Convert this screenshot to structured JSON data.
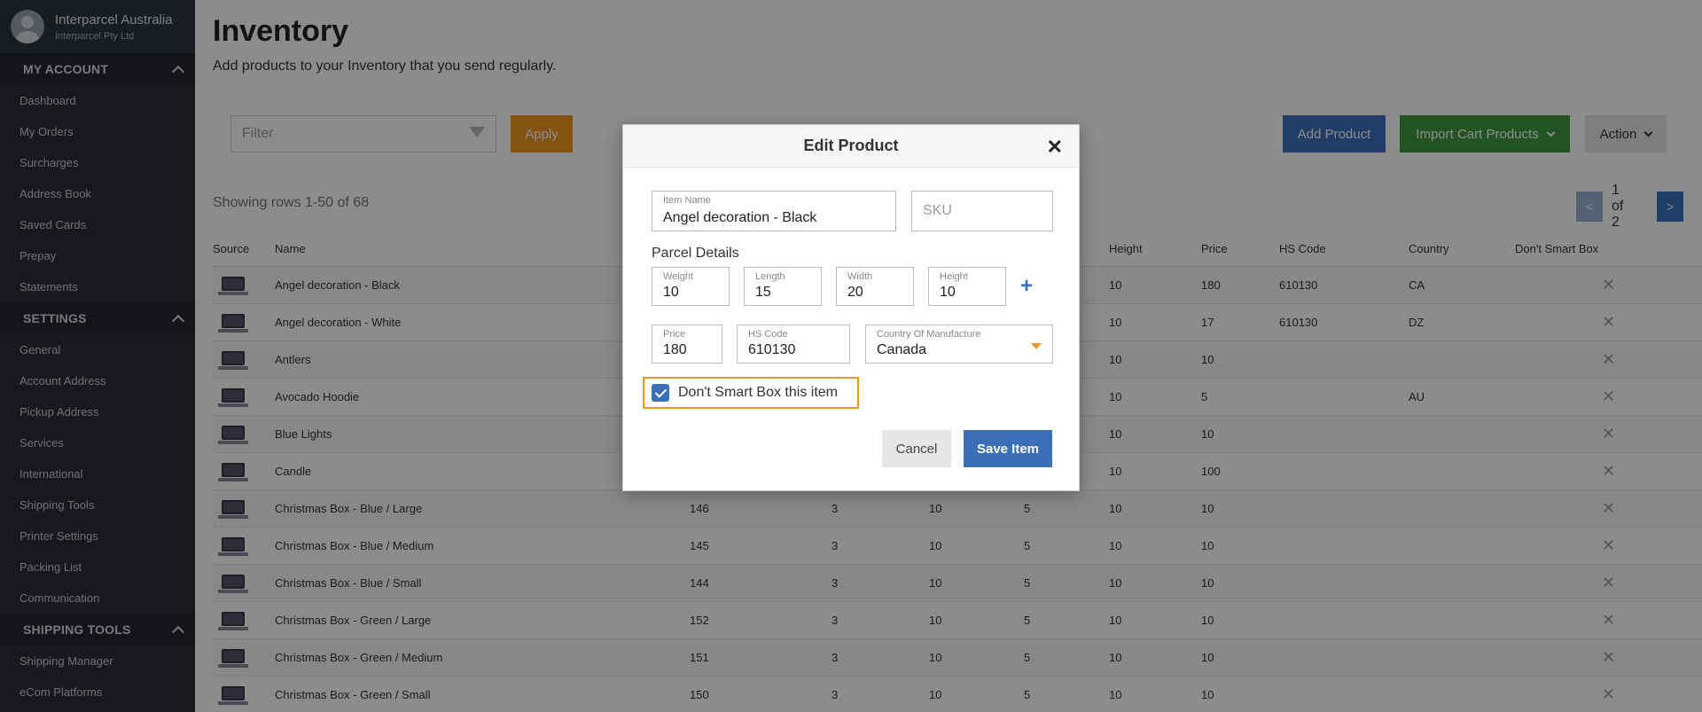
{
  "sidebar": {
    "profile_name": "Interparcel Australia",
    "profile_company": "Interparcel Pty Ltd",
    "sections": [
      {
        "title": "MY ACCOUNT",
        "items": [
          "Dashboard",
          "My Orders",
          "Surcharges",
          "Address Book",
          "Saved Cards",
          "Prepay",
          "Statements"
        ]
      },
      {
        "title": "SETTINGS",
        "items": [
          "General",
          "Account Address",
          "Pickup Address",
          "Services",
          "International",
          "Shipping Tools",
          "Printer Settings",
          "Packing List",
          "Communication"
        ]
      },
      {
        "title": "SHIPPING TOOLS",
        "items": [
          "Shipping Manager",
          "eCom Platforms"
        ]
      }
    ]
  },
  "page": {
    "title": "Inventory",
    "subtitle": "Add products to your Inventory that you send regularly.",
    "filter_placeholder": "Filter",
    "apply_label": "Apply",
    "add_product_label": "Add Product",
    "import_label": "Import Cart Products",
    "action_label": "Action",
    "rows_info": "Showing rows 1-50 of 68",
    "pager_prev": "<",
    "pager_text": "1 of 2",
    "pager_next": ">"
  },
  "table": {
    "headers": [
      "Source",
      "Name",
      "",
      "",
      "",
      "",
      "Height",
      "Price",
      "HS Code",
      "Country",
      "Don't Smart Box"
    ],
    "rows": [
      {
        "name": "Angel decoration - Black",
        "c1": "",
        "c2": "",
        "c3": "",
        "c4": "",
        "height": "10",
        "price": "180",
        "hs": "610130",
        "country": "CA"
      },
      {
        "name": "Angel decoration - White",
        "c1": "",
        "c2": "",
        "c3": "",
        "c4": "",
        "height": "10",
        "price": "17",
        "hs": "610130",
        "country": "DZ"
      },
      {
        "name": "Antlers",
        "c1": "",
        "c2": "",
        "c3": "",
        "c4": "",
        "height": "10",
        "price": "10",
        "hs": "",
        "country": ""
      },
      {
        "name": "Avocado Hoodie",
        "c1": "",
        "c2": "",
        "c3": "",
        "c4": "",
        "height": "10",
        "price": "5",
        "hs": "",
        "country": "AU"
      },
      {
        "name": "Blue Lights",
        "c1": "",
        "c2": "",
        "c3": "",
        "c4": "",
        "height": "10",
        "price": "10",
        "hs": "",
        "country": ""
      },
      {
        "name": "Candle",
        "c1": "",
        "c2": "",
        "c3": "",
        "c4": "",
        "height": "10",
        "price": "100",
        "hs": "",
        "country": ""
      },
      {
        "name": "Christmas Box - Blue / Large",
        "c1": "146",
        "c2": "3",
        "c3": "10",
        "c4": "5",
        "height": "10",
        "price": "10",
        "hs": "",
        "country": ""
      },
      {
        "name": "Christmas Box - Blue / Medium",
        "c1": "145",
        "c2": "3",
        "c3": "10",
        "c4": "5",
        "height": "10",
        "price": "10",
        "hs": "",
        "country": ""
      },
      {
        "name": "Christmas Box - Blue / Small",
        "c1": "144",
        "c2": "3",
        "c3": "10",
        "c4": "5",
        "height": "10",
        "price": "10",
        "hs": "",
        "country": ""
      },
      {
        "name": "Christmas Box - Green / Large",
        "c1": "152",
        "c2": "3",
        "c3": "10",
        "c4": "5",
        "height": "10",
        "price": "10",
        "hs": "",
        "country": ""
      },
      {
        "name": "Christmas Box - Green / Medium",
        "c1": "151",
        "c2": "3",
        "c3": "10",
        "c4": "5",
        "height": "10",
        "price": "10",
        "hs": "",
        "country": ""
      },
      {
        "name": "Christmas Box - Green / Small",
        "c1": "150",
        "c2": "3",
        "c3": "10",
        "c4": "5",
        "height": "10",
        "price": "10",
        "hs": "",
        "country": ""
      }
    ],
    "delete_glyph": "✕"
  },
  "modal": {
    "title": "Edit Product",
    "close_glyph": "✕",
    "item_name_label": "Item Name",
    "item_name_value": "Angel decoration - Black",
    "sku_placeholder": "SKU",
    "parcel_details_label": "Parcel Details",
    "weight_label": "Weight",
    "weight_value": "10",
    "length_label": "Length",
    "length_value": "15",
    "width_label": "Width",
    "width_value": "20",
    "height_label": "Height",
    "height_value": "10",
    "plus_glyph": "+",
    "price_label": "Price",
    "price_value": "180",
    "hs_label": "HS Code",
    "hs_value": "610130",
    "country_label": "Country Of Manufacture",
    "country_value": "Canada",
    "checkbox_label": "Don't Smart Box this item",
    "checkbox_checked": true,
    "cancel_label": "Cancel",
    "save_label": "Save Item"
  },
  "colors": {
    "sidebar_bg": "#2a2f36",
    "primary": "#3a6fb8",
    "orange": "#f0951e",
    "green": "#3e9a3e"
  }
}
